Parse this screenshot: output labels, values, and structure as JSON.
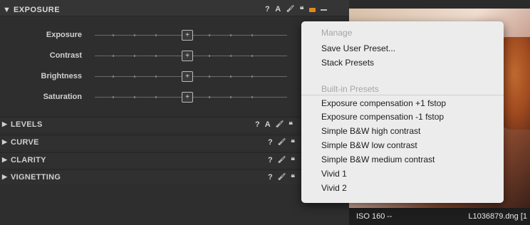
{
  "exposure_panel": {
    "title": "▼ EXPOSURE",
    "header_icons": {
      "help": "?",
      "auto": "A",
      "wand": "🖌",
      "presets": "❝"
    },
    "sliders": [
      {
        "label": "Exposure",
        "knob": "+"
      },
      {
        "label": "Contrast",
        "knob": "+"
      },
      {
        "label": "Brightness",
        "knob": "+"
      },
      {
        "label": "Saturation",
        "knob": "+"
      }
    ]
  },
  "sections": [
    {
      "arrow": "▶",
      "name": "LEVELS",
      "icons": [
        "?",
        "A",
        "🖌",
        "❝"
      ]
    },
    {
      "arrow": "▶",
      "name": "CURVE",
      "icons": [
        "?",
        "🖌",
        "❝"
      ]
    },
    {
      "arrow": "▶",
      "name": "CLARITY",
      "icons": [
        "?",
        "🖌",
        "❝"
      ]
    },
    {
      "arrow": "▶",
      "name": "VIGNETTING",
      "icons": [
        "?",
        "🖌",
        "❝"
      ]
    }
  ],
  "photo_status": {
    "iso": "ISO 160",
    "separator": "--",
    "filename": "L1036879.dng [1"
  },
  "preset_menu": {
    "manage_header": "Manage",
    "manage_items": [
      "Save User Preset...",
      "Stack Presets"
    ],
    "builtin_header": "Built-in Presets",
    "builtin_items": [
      "Exposure compensation +1 fstop",
      "Exposure compensation -1 fstop",
      "Simple B&W high contrast",
      "Simple B&W low contrast",
      "Simple B&W medium contrast",
      "Vivid 1",
      "Vivid 2"
    ]
  },
  "colors": {
    "accent": "#e08a1e",
    "menu_bg": "#ececec",
    "panel_bg": "#2e2e2e"
  }
}
